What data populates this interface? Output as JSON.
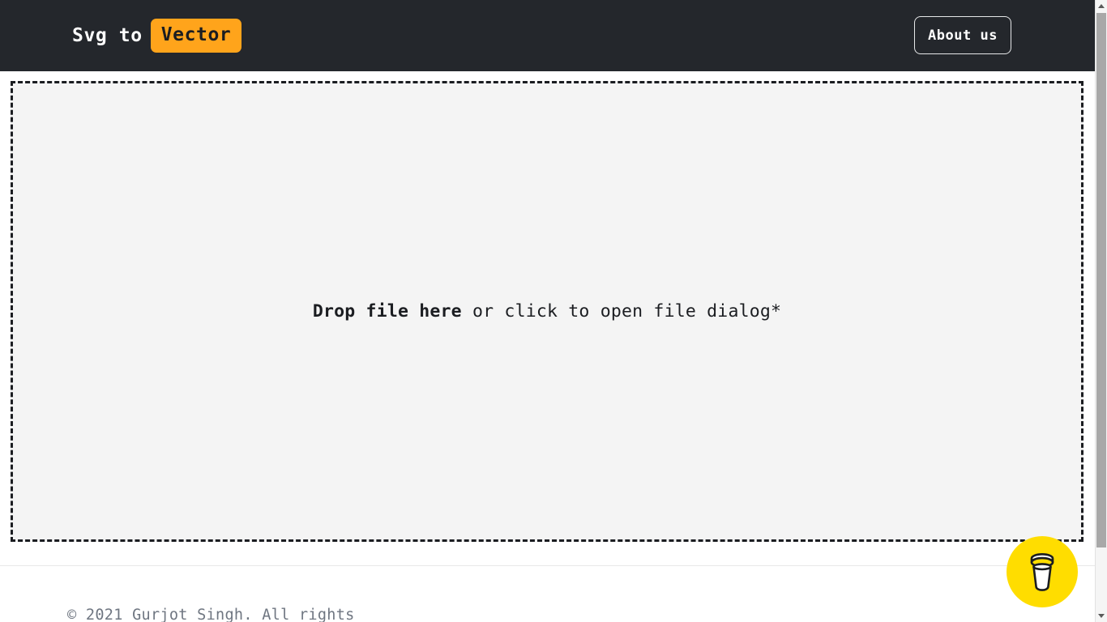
{
  "header": {
    "brand_prefix": "Svg to",
    "brand_badge": "Vector",
    "about_label": "About us",
    "background_color": "#24272c",
    "badge_color": "#ffa41b"
  },
  "main": {
    "dropzone": {
      "bold_text": "Drop file here",
      "rest_text": " or click to open file dialog*",
      "background_color": "#f4f4f4",
      "border_color": "#1b1d21",
      "border_style": "dashed"
    }
  },
  "footer": {
    "copyright": "© 2021 Gurjot Singh. All rights",
    "text_color": "#6f7681"
  },
  "floating": {
    "coffee_button_label": "buy-me-a-coffee",
    "coffee_button_color": "#ffdd00",
    "icon": "coffee-cup-icon"
  },
  "scrollbar": {
    "up_icon": "scroll-up-arrow-icon",
    "down_icon": "scroll-down-arrow-icon",
    "thumb_color": "#a8a8a8",
    "track_color": "#f5f5f5"
  }
}
